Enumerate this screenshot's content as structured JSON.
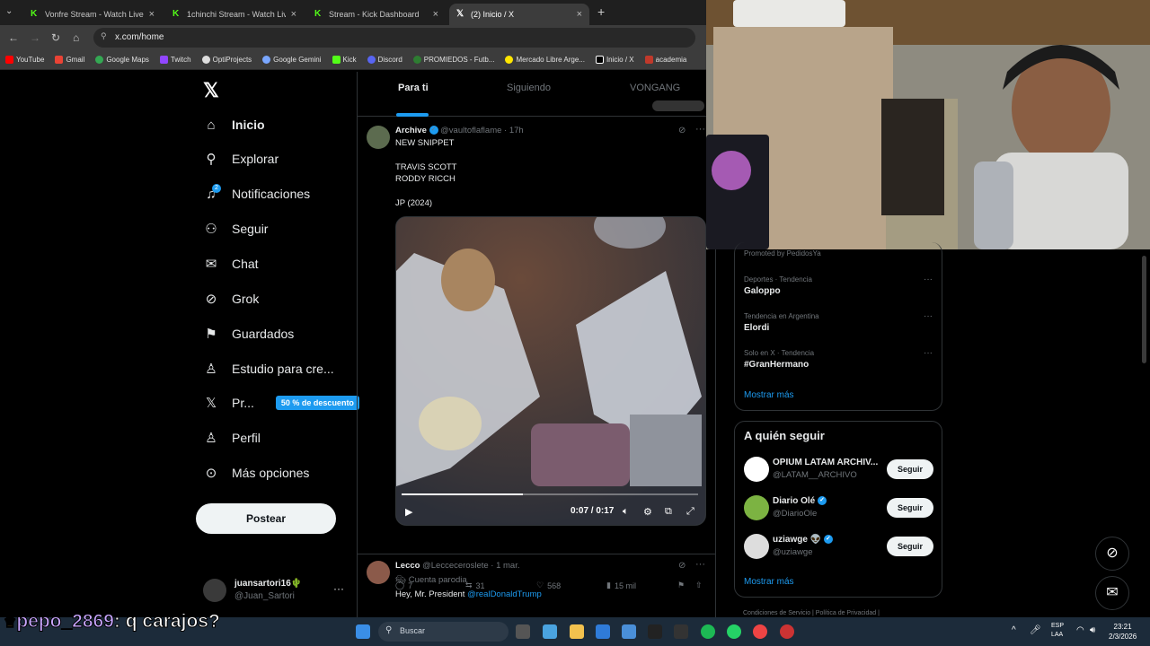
{
  "browser": {
    "tabs": [
      {
        "label": "Vonfre Stream - Watch Live on",
        "icon": "kick-icon"
      },
      {
        "label": "1chinchi Stream - Watch Live o",
        "icon": "kick-icon"
      },
      {
        "label": "Stream - Kick Dashboard",
        "icon": "kick-icon"
      },
      {
        "label": "(2) Inicio / X",
        "icon": "x-icon"
      }
    ],
    "url": "x.com/home",
    "bookmarks": [
      "YouTube",
      "Gmail",
      "Google Maps",
      "Twitch",
      "OptiProjects",
      "Google Gemini",
      "Kick",
      "Discord",
      "PROMIEDOS - Futb...",
      "Mercado Libre Arge...",
      "Inicio / X",
      "academia"
    ]
  },
  "nav": {
    "items": [
      "Inicio",
      "Explorar",
      "Notificaciones",
      "Seguir",
      "Chat",
      "Grok",
      "Guardados",
      "Estudio para cre...",
      "Pr...",
      "Perfil",
      "Más opciones"
    ],
    "notif_count": "2",
    "premium_badge": "50 % de descuento",
    "post_button": "Postear",
    "account_name": "juansartori16🌵",
    "account_handle": "@Juan_Sartori"
  },
  "feed": {
    "tabs": [
      "Para ti",
      "Siguiendo",
      "VONGANG"
    ],
    "tweet1": {
      "name": "Archive",
      "handle": "@vaultoflaflame",
      "time": "· 17h",
      "lines": [
        "NEW SNIPPET",
        "",
        "TRAVIS SCOTT",
        "RODDY RICCH",
        "",
        "JP (2024)"
      ],
      "video_time": "0:07 / 0:17",
      "progress": 0.41,
      "replies": "7",
      "reposts": "31",
      "likes": "568",
      "views": "15 mil"
    },
    "tweet2": {
      "name": "Lecco",
      "handle": "@Lecceceroslete",
      "time": "· 1 mar.",
      "label": "Cuenta parodia",
      "text": "Hey, Mr. President",
      "mention": "@realDonaldTrump"
    }
  },
  "trends": {
    "promoted": "Promoted by PedidosYa",
    "items": [
      {
        "category": "Deportes · Tendencia",
        "name": "Galoppo"
      },
      {
        "category": "Tendencia en Argentina",
        "name": "Elordi"
      },
      {
        "category": "Solo en X · Tendencia",
        "name": "#GranHermano"
      }
    ],
    "show_more": "Mostrar más"
  },
  "who_to_follow": {
    "title": "A quién seguir",
    "follow_label": "Seguir",
    "accounts": [
      {
        "name": "OPIUM LATAM ARCHIV...",
        "handle": "@LATAM__ARCHIVO"
      },
      {
        "name": "Diario Olé",
        "handle": "@DiarioOle"
      },
      {
        "name": "uziawge 👽",
        "handle": "@uziawge"
      }
    ],
    "show_more": "Mostrar más"
  },
  "footer": "Condiciones de Servicio   |   Política de Privacidad   |",
  "taskbar": {
    "search": "Buscar",
    "lang": "ESP\nLAA",
    "time": "23:21",
    "date": "2/3/2026"
  },
  "chat_overlay": {
    "user": "pepo_2869",
    "message": ": q carajos?"
  },
  "colors": {
    "accent": "#1d9bf0",
    "bg": "#000000",
    "kick": "#53fc18"
  }
}
